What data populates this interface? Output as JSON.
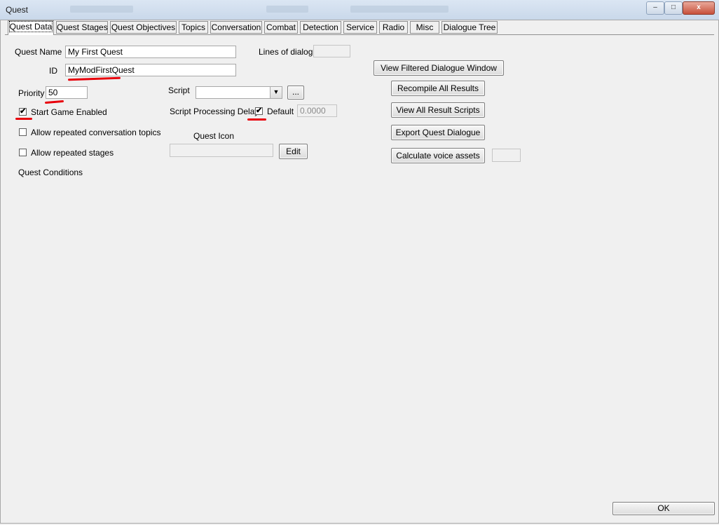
{
  "window": {
    "title": "Quest",
    "minimize_glyph": "–",
    "maximize_glyph": "□",
    "close_glyph": "x"
  },
  "tabs": [
    {
      "label": "Quest Data",
      "active": true
    },
    {
      "label": "Quest Stages"
    },
    {
      "label": "Quest Objectives"
    },
    {
      "label": "Topics"
    },
    {
      "label": "Conversation"
    },
    {
      "label": "Combat"
    },
    {
      "label": "Detection"
    },
    {
      "label": "Service"
    },
    {
      "label": "Radio"
    },
    {
      "label": "Misc"
    },
    {
      "label": "Dialogue Tree"
    }
  ],
  "form": {
    "quest_name_label": "Quest Name",
    "quest_name_value": "My First Quest",
    "id_label": "ID",
    "id_value": "MyModFirstQuest",
    "priority_label": "Priority",
    "priority_value": "50",
    "start_game_enabled_label": "Start Game Enabled",
    "start_game_enabled_checked": true,
    "allow_repeated_topics_label": "Allow repeated conversation topics",
    "allow_repeated_topics_checked": false,
    "allow_repeated_stages_label": "Allow repeated stages",
    "allow_repeated_stages_checked": false,
    "quest_conditions_label": "Quest Conditions",
    "script_label": "Script",
    "script_value": "",
    "script_browse_label": "...",
    "script_delay_label": "Script Processing Delay",
    "default_label": "Default",
    "default_checked": true,
    "delay_value": "0.0000",
    "quest_icon_label": "Quest Icon",
    "quest_icon_value": "",
    "edit_label": "Edit",
    "lines_of_dialog_label": "Lines of dialog:",
    "lines_of_dialog_value": "",
    "voice_assets_value": "",
    "check_glyph": "✔"
  },
  "buttons": {
    "view_filtered": "View Filtered Dialogue Window",
    "recompile": "Recompile All Results",
    "view_scripts": "View All Result Scripts",
    "export_dialogue": "Export Quest Dialogue",
    "calc_voice": "Calculate voice assets",
    "ok": "OK"
  },
  "annotation_color": "#e8000b"
}
